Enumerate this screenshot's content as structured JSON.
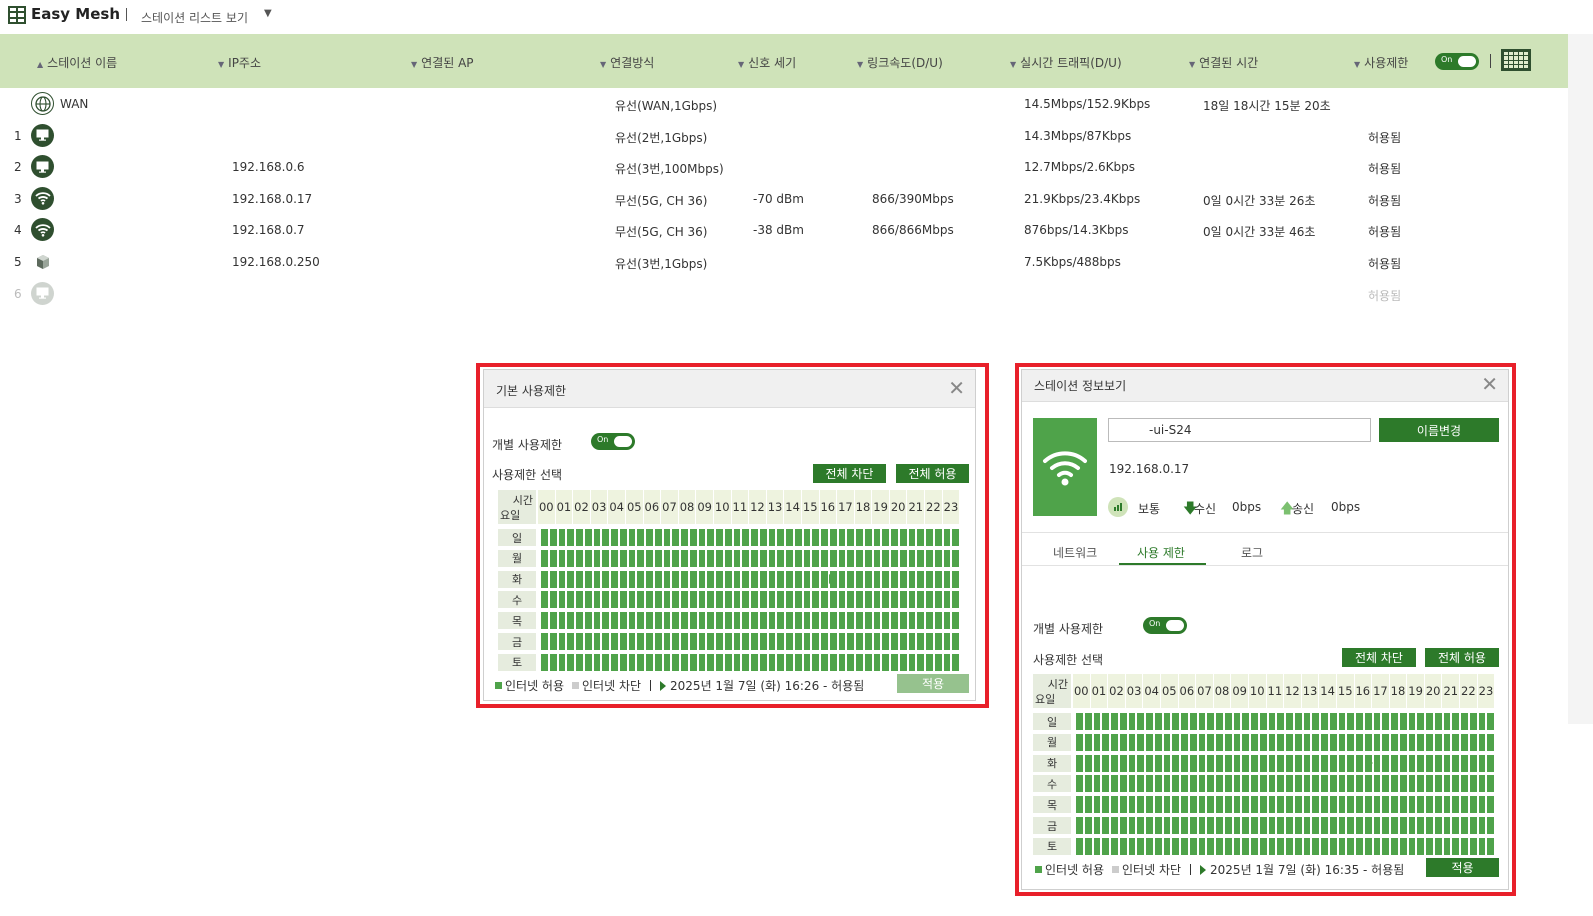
{
  "app": {
    "title": "Easy Mesh",
    "breadcrumb": "스테이션 리스트 보기",
    "breadcrumb_arrow": "▼"
  },
  "table": {
    "headers": {
      "name": "스테이션 이름",
      "ip": "IP주소",
      "ap": "연결된 AP",
      "conn": "연결방식",
      "signal": "신호 세기",
      "link": "링크속도(D/U)",
      "traffic": "실시간 트래픽(D/U)",
      "time": "연결된 시간",
      "limit": "사용제한"
    },
    "sort_asc": "▲",
    "sort_desc": "▼",
    "toggle_label": "On",
    "rows": [
      {
        "num": "",
        "icon": "globe-icon",
        "name": "WAN",
        "ip": "",
        "conn": "유선(WAN,1Gbps)",
        "signal": "",
        "link": "",
        "traffic": "14.5Mbps/152.9Kbps",
        "time": "18일 18시간 15분 20초",
        "limit": ""
      },
      {
        "num": "1",
        "icon": "monitor-icon",
        "name": "",
        "ip": "",
        "conn": "유선(2번,1Gbps)",
        "signal": "",
        "link": "",
        "traffic": "14.3Mbps/87Kbps",
        "time": "",
        "limit": "허용됨"
      },
      {
        "num": "2",
        "icon": "monitor-icon",
        "name": "",
        "ip": "192.168.0.6",
        "conn": "유선(3번,100Mbps)",
        "signal": "",
        "link": "",
        "traffic": "12.7Mbps/2.6Kbps",
        "time": "",
        "limit": "허용됨"
      },
      {
        "num": "3",
        "icon": "wifi-icon",
        "name": "",
        "ip": "192.168.0.17",
        "conn": "무선(5G, CH 36)",
        "signal": "-70 dBm",
        "link": "866/390Mbps",
        "traffic": "21.9Kbps/23.4Kbps",
        "time": "0일 0시간 33분 26초",
        "limit": "허용됨"
      },
      {
        "num": "4",
        "icon": "wifi-icon",
        "name": "",
        "ip": "192.168.0.7",
        "conn": "무선(5G, CH 36)",
        "signal": "-38 dBm",
        "link": "866/866Mbps",
        "traffic": "876bps/14.3Kbps",
        "time": "0일 0시간 33분 46초",
        "limit": "허용됨"
      },
      {
        "num": "5",
        "icon": "cube-icon",
        "name": "",
        "ip": "192.168.0.250",
        "conn": "유선(3번,1Gbps)",
        "signal": "",
        "link": "",
        "traffic": "7.5Kbps/488bps",
        "time": "",
        "limit": "허용됨"
      },
      {
        "num": "6",
        "icon": "monitor-icon",
        "name": "",
        "ip": "",
        "conn": "",
        "signal": "",
        "link": "",
        "traffic": "",
        "time": "",
        "limit": "허용됨"
      }
    ]
  },
  "schedule": {
    "corner_time": "시간",
    "corner_day": "요일",
    "hours": [
      "00",
      "01",
      "02",
      "03",
      "04",
      "05",
      "06",
      "07",
      "08",
      "09",
      "10",
      "11",
      "12",
      "13",
      "14",
      "15",
      "16",
      "17",
      "18",
      "19",
      "20",
      "21",
      "22",
      "23"
    ],
    "days": [
      "일",
      "월",
      "화",
      "수",
      "목",
      "금",
      "토"
    ],
    "legend_allow": "인터넷 허용",
    "legend_block": "인터넷 차단",
    "colors": {
      "allow": "#4fa34a",
      "block": "#cccccc",
      "accent": "#2d7a2a"
    }
  },
  "basic_dialog": {
    "title": "기본 사용제한",
    "individual_label": "개별 사용제한",
    "toggle_label": "On",
    "select_label": "사용제한 선택",
    "block_all": "전체 차단",
    "allow_all": "전체 허용",
    "status": "2025년 1월 7일 (화) 16:26 - 허용됨",
    "apply": "적용"
  },
  "station_dialog": {
    "title": "스테이션 정보보기",
    "name_value": "-ui-S24",
    "rename": "이름변경",
    "ip": "192.168.0.17",
    "signal_label": "보통",
    "rx_label": "수신",
    "rx_value": "0bps",
    "tx_label": "송신",
    "tx_value": "0bps",
    "tabs": [
      "네트워크",
      "사용 제한",
      "로그"
    ],
    "individual_label": "개별 사용제한",
    "toggle_label": "On",
    "select_label": "사용제한 선택",
    "block_all": "전체 차단",
    "allow_all": "전체 허용",
    "status": "2025년 1월 7일 (화) 16:35 - 허용됨",
    "apply": "적용"
  }
}
